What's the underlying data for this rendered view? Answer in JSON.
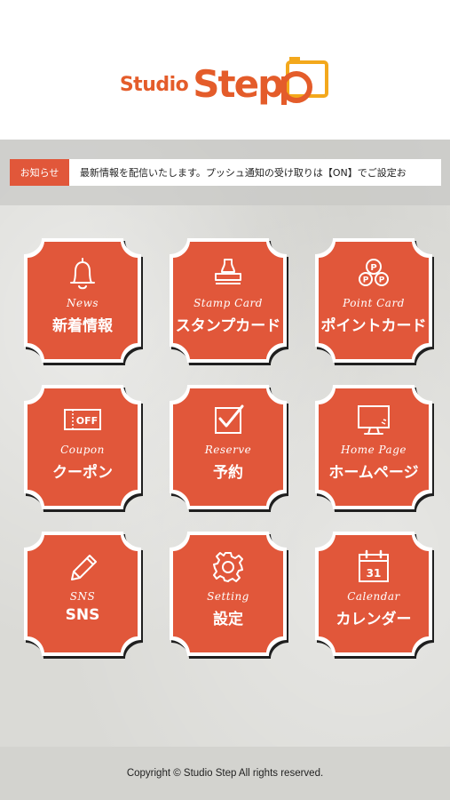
{
  "logo": {
    "studio": "Studio",
    "step": "Step"
  },
  "news": {
    "tag": "お知らせ",
    "text": "最新情報を配信いたします。プッシュ通知の受け取りは【ON】でご設定お"
  },
  "tiles": [
    {
      "en": "News",
      "ja": "新着情報",
      "icon": "bell-icon"
    },
    {
      "en": "Stamp Card",
      "ja": "スタンプカード",
      "icon": "stamp-icon"
    },
    {
      "en": "Point Card",
      "ja": "ポイントカード",
      "icon": "points-icon"
    },
    {
      "en": "Coupon",
      "ja": "クーポン",
      "icon": "coupon-icon",
      "badge": "OFF"
    },
    {
      "en": "Reserve",
      "ja": "予約",
      "icon": "checkbox-icon"
    },
    {
      "en": "Home Page",
      "ja": "ホームページ",
      "icon": "monitor-icon"
    },
    {
      "en": "SNS",
      "ja": "SNS",
      "icon": "pencil-icon"
    },
    {
      "en": "Setting",
      "ja": "設定",
      "icon": "gear-icon"
    },
    {
      "en": "Calendar",
      "ja": "カレンダー",
      "icon": "calendar-icon",
      "badge": "31"
    }
  ],
  "footer": {
    "copyright": "Copyright © Studio Step All rights reserved."
  },
  "colors": {
    "accent": "#e45c2a",
    "tile": "#e1573a",
    "background": "#dadad6"
  }
}
